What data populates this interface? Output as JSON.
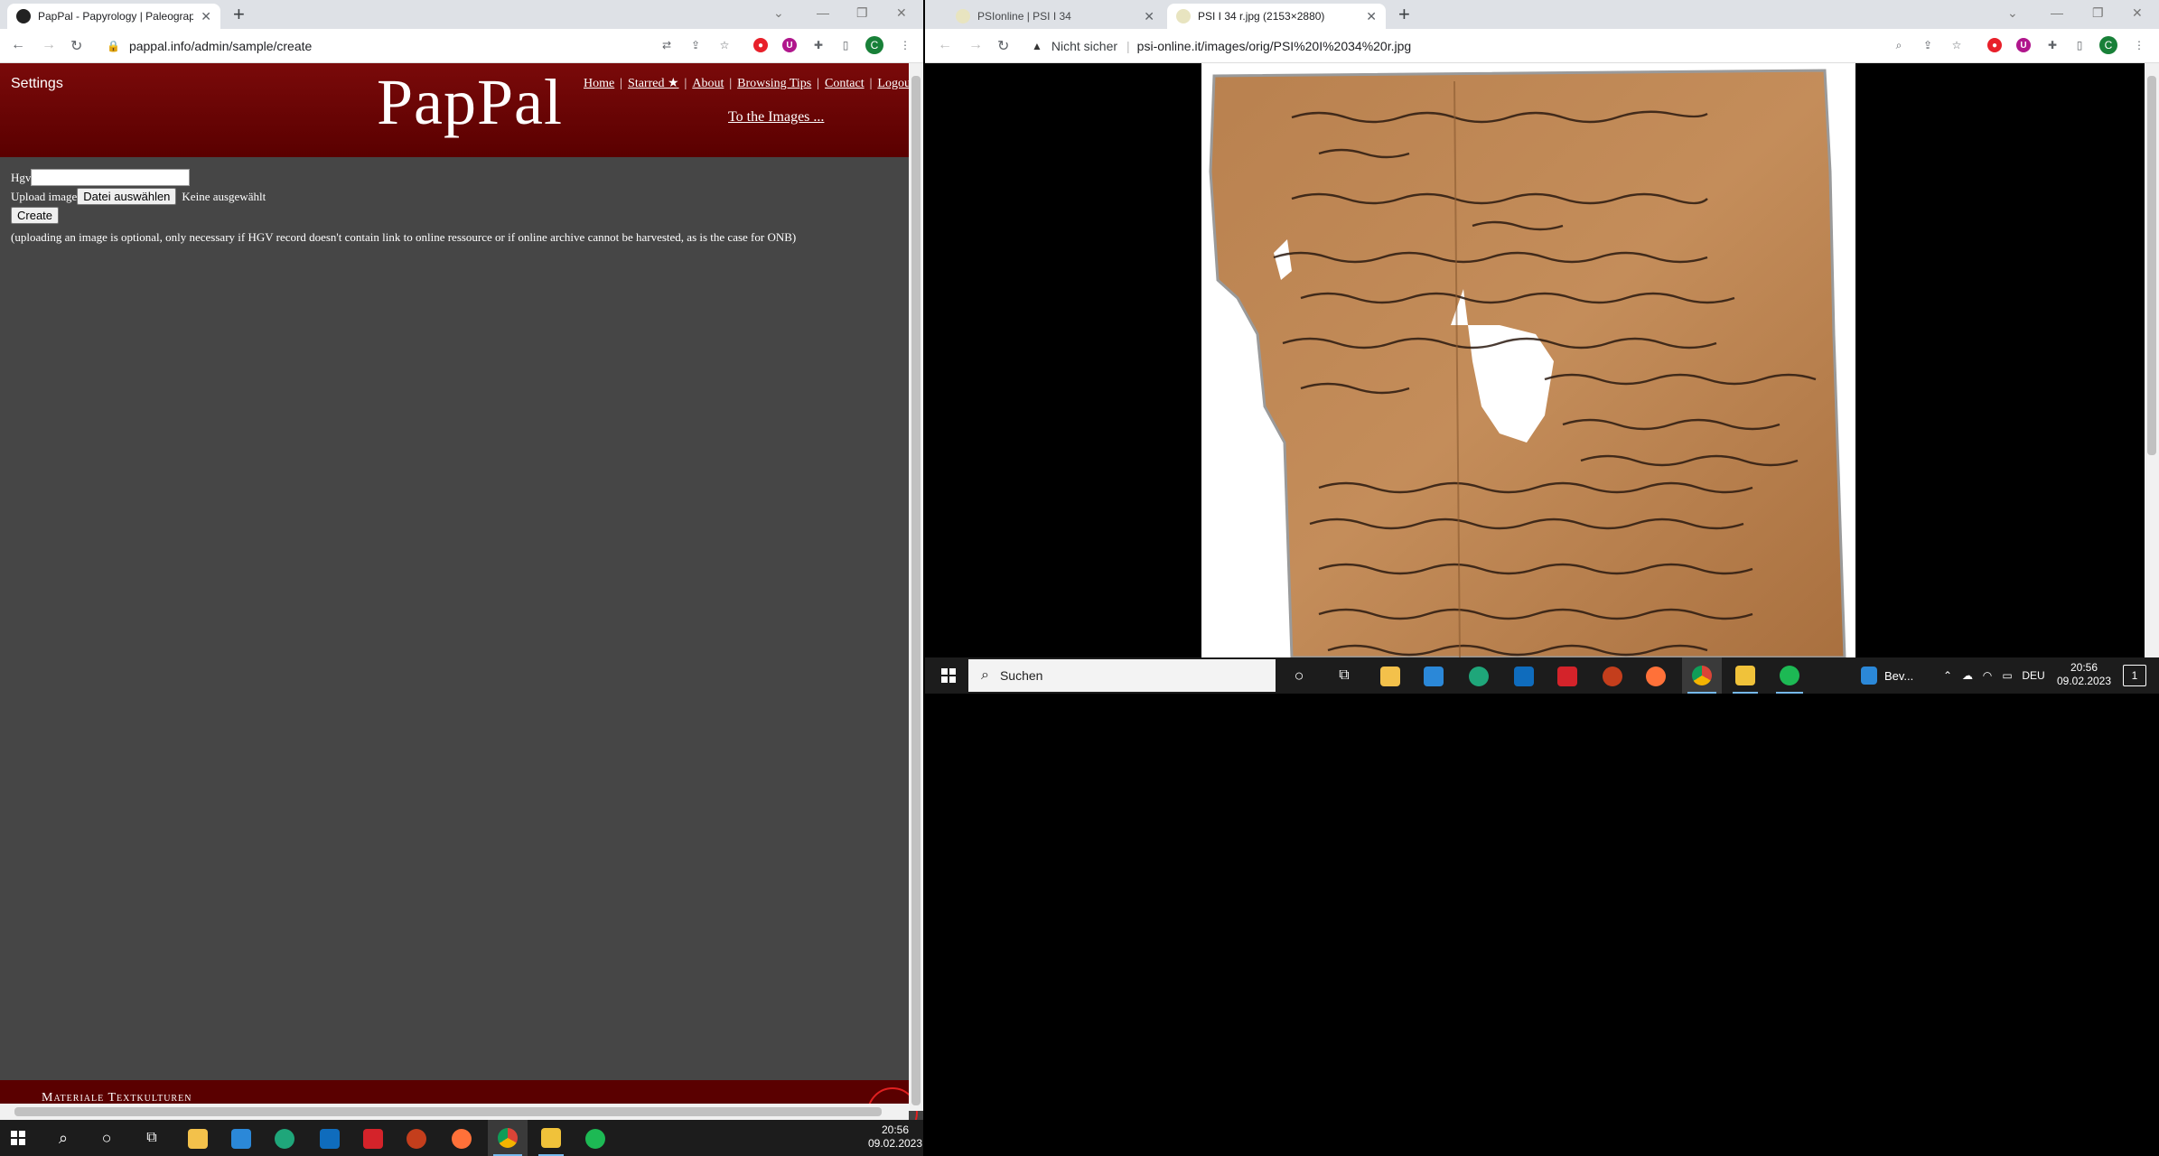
{
  "left_browser": {
    "tabs": [
      {
        "title": "PapPal - Papyrology | Paleography",
        "active": true
      }
    ],
    "url": "pappal.info/admin/sample/create",
    "profile_initial": "C"
  },
  "pappal": {
    "settings_label": "Settings",
    "logo": "PapPal",
    "nav": [
      "Home",
      "Starred ★",
      "About",
      "Browsing Tips",
      "Contact",
      "Logout"
    ],
    "to_images": "To the Images ...",
    "form": {
      "hgv_label": "Hgv",
      "hgv_value": "",
      "upload_label": "Upload image",
      "file_button": "Datei auswählen",
      "file_status": "Keine ausgewählt",
      "create_button": "Create",
      "note": "(uploading an image is optional, only necessary if HGV record doesn't contain link to online ressource or if online archive cannot be harvested, as is the case for ONB)"
    },
    "footer_text": "Materiale Textkulturen"
  },
  "right_browser": {
    "tabs": [
      {
        "title": "PSIonline | PSI I 34",
        "active": false
      },
      {
        "title": "PSI I 34 r.jpg (2153×2880)",
        "active": true
      }
    ],
    "security_label": "Nicht sicher",
    "url": "psi-online.it/images/orig/PSI%20I%2034%20r.jpg",
    "profile_initial": "C"
  },
  "taskbar_left": {
    "time": "20:56",
    "date": "09.02.2023"
  },
  "taskbar_right": {
    "search_placeholder": "Suchen",
    "app_label": "Bev...",
    "language": "DEU",
    "time": "20:56",
    "date": "09.02.2023",
    "notification_count": "1"
  }
}
